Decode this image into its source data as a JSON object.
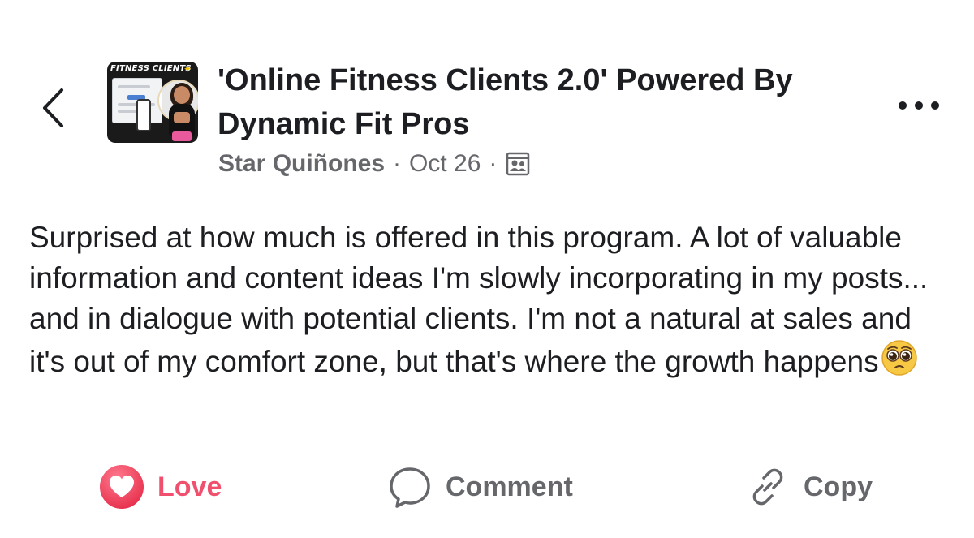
{
  "header": {
    "thumbnail_label": "FITNESS CLIENTS",
    "group_title": "'Online Fitness Clients 2.0' Powered By Dynamic Fit Pros",
    "author": "Star Quiñones",
    "date": "Oct 26",
    "separator": "·",
    "audience_icon": "group-audience-icon",
    "back_icon": "chevron-left-icon",
    "more_icon": "more-horizontal-icon"
  },
  "post": {
    "text": "Surprised at how much is offered in this program. A lot of valuable information and content ideas I'm slowly incorporating in my posts... and in dialogue with potential clients. I'm not a natural at sales and it's out of my comfort zone, but that's where the growth happens",
    "emoji": "pleading-face-emoji"
  },
  "actions": {
    "love_label": "Love",
    "comment_label": "Comment",
    "copy_label": "Copy"
  },
  "colors": {
    "love": "#f0506e",
    "muted": "#65676b",
    "text": "#1c1e21"
  }
}
